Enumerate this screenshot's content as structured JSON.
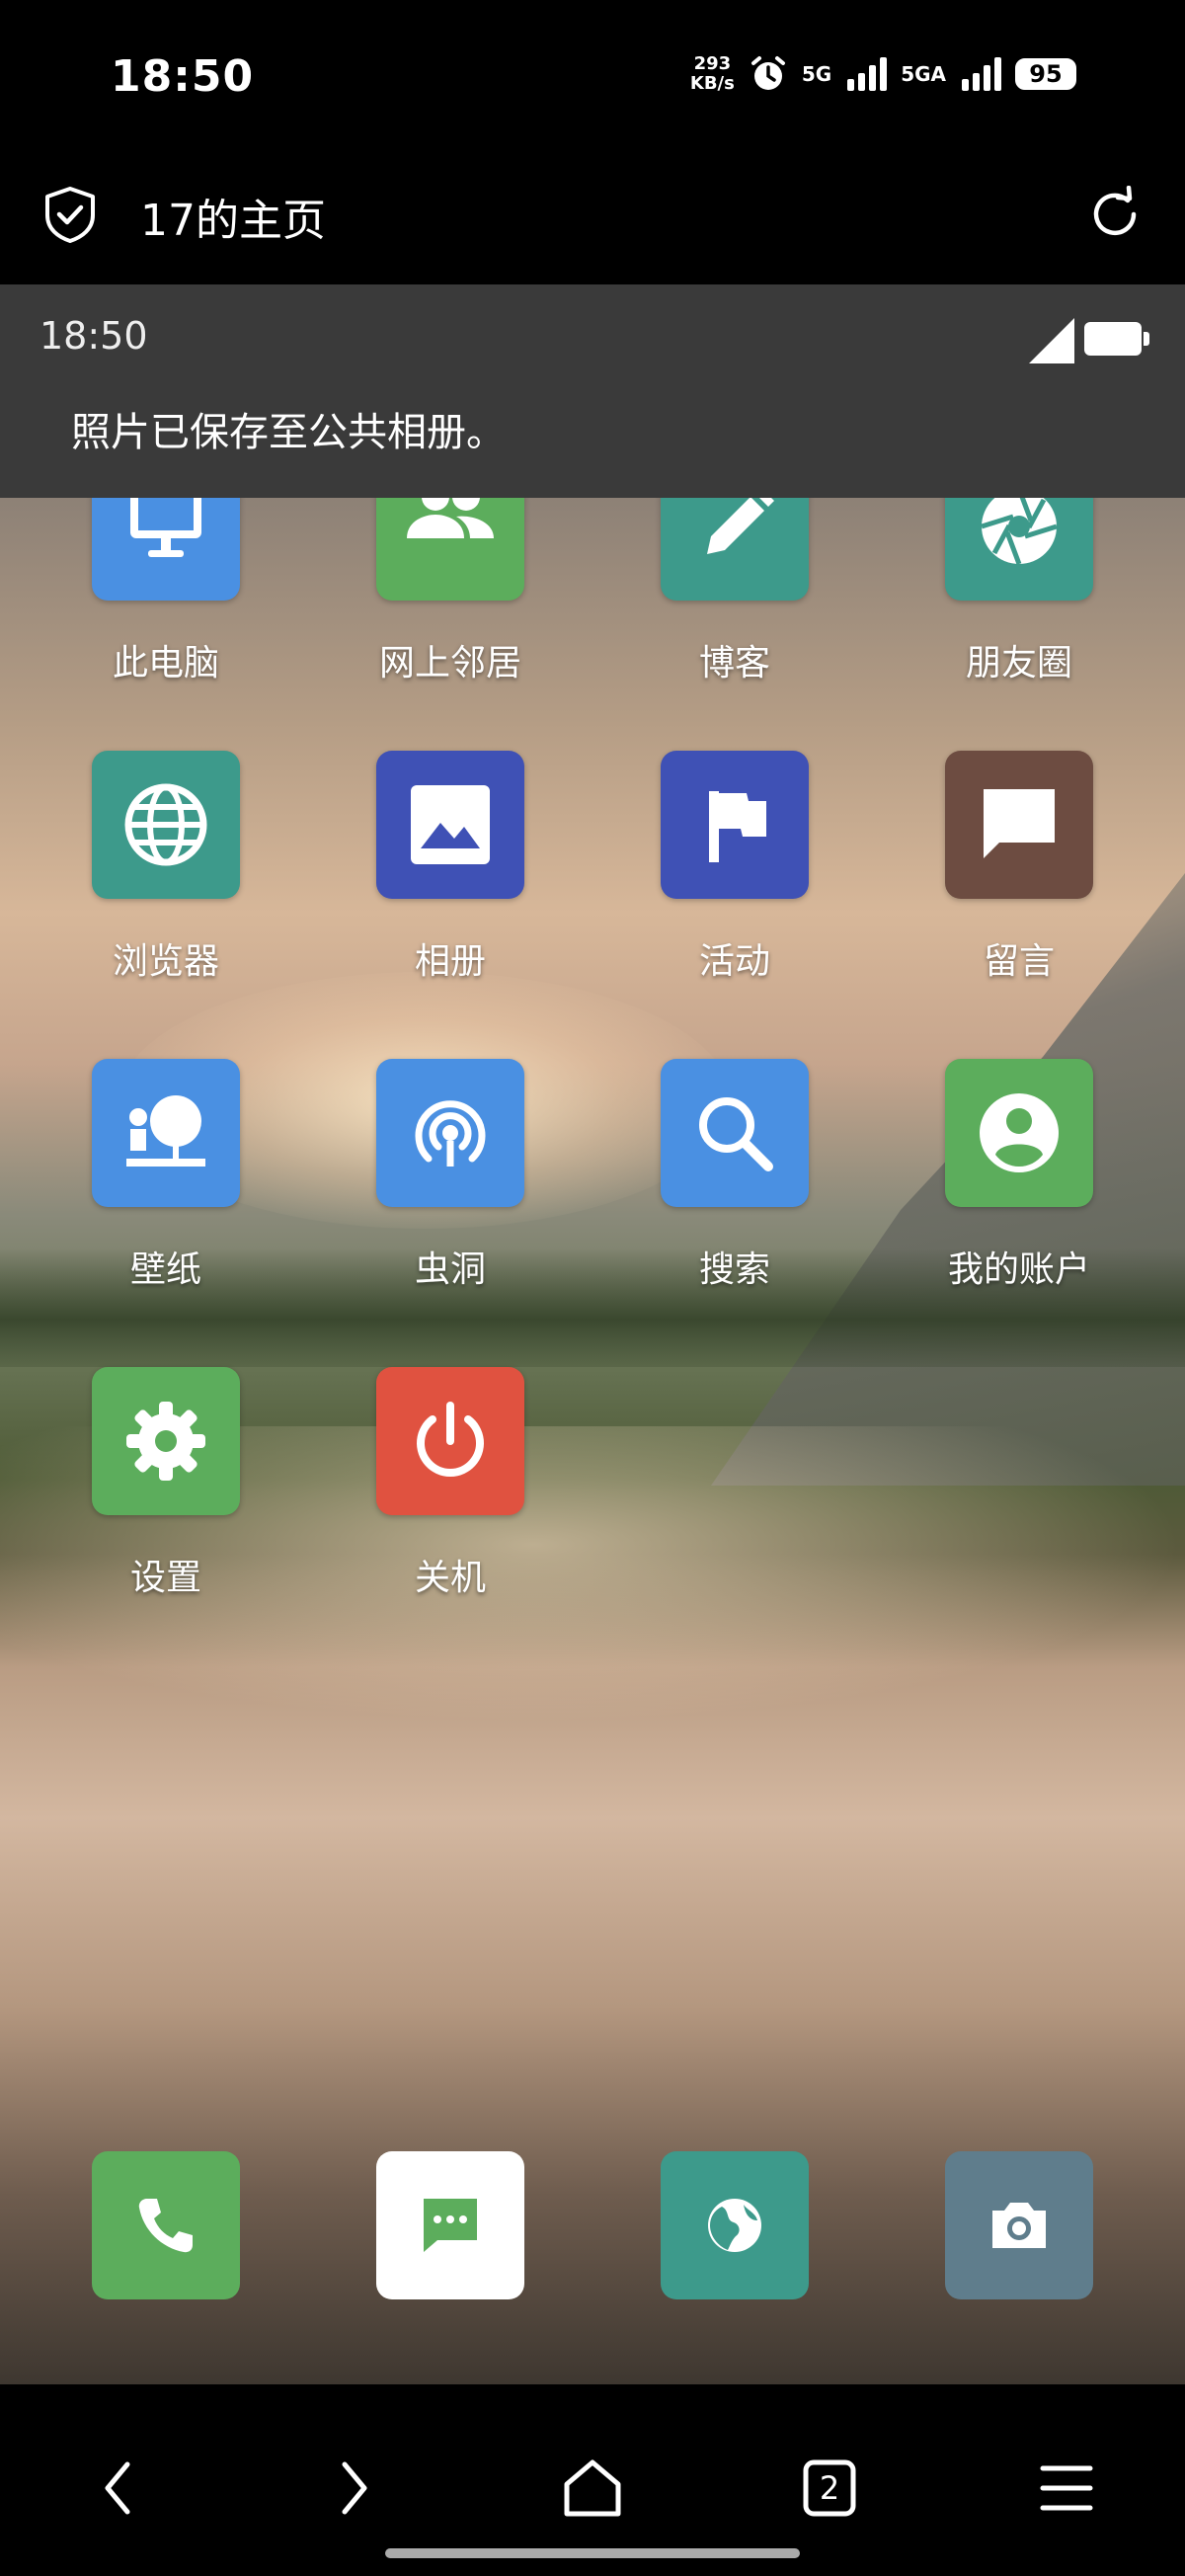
{
  "status_bar": {
    "time": "18:50",
    "net_speed_value": "293",
    "net_speed_unit": "KB/s",
    "network_1": "5G",
    "network_2": "5GA",
    "battery": "95"
  },
  "browser": {
    "page_title": "17的主页",
    "tab_count": "2"
  },
  "notification": {
    "time": "18:50",
    "message": "照片已保存至公共相册。"
  },
  "apps": [
    {
      "label": "此电脑",
      "icon": "monitor-icon",
      "color": "#4a90e2"
    },
    {
      "label": "网上邻居",
      "icon": "people-icon",
      "color": "#5cad5c"
    },
    {
      "label": "博客",
      "icon": "pencil-icon",
      "color": "#3d9a8b"
    },
    {
      "label": "朋友圈",
      "icon": "aperture-icon",
      "color": "#3d9a8b"
    },
    {
      "label": "浏览器",
      "icon": "globe-icon",
      "color": "#3d9a8b"
    },
    {
      "label": "相册",
      "icon": "image-icon",
      "color": "#3f51b5"
    },
    {
      "label": "活动",
      "icon": "flag-icon",
      "color": "#3f51b5"
    },
    {
      "label": "留言",
      "icon": "chat-icon",
      "color": "#6d4c41"
    },
    {
      "label": "壁纸",
      "icon": "wallpaper-icon",
      "color": "#4a90e2"
    },
    {
      "label": "虫洞",
      "icon": "broadcast-icon",
      "color": "#4a90e2"
    },
    {
      "label": "搜索",
      "icon": "search-icon",
      "color": "#4a90e2"
    },
    {
      "label": "我的账户",
      "icon": "account-icon",
      "color": "#5cad5c"
    },
    {
      "label": "设置",
      "icon": "gear-icon",
      "color": "#5cad5c"
    },
    {
      "label": "关机",
      "icon": "power-icon",
      "color": "#e05240"
    }
  ],
  "dock": [
    {
      "icon": "phone-icon",
      "color": "#5cad5c"
    },
    {
      "icon": "message-icon",
      "color": "#ffffff"
    },
    {
      "icon": "browser-globe-icon",
      "color": "#3d9a8b"
    },
    {
      "icon": "camera-icon",
      "color": "#5f7d8c"
    }
  ]
}
